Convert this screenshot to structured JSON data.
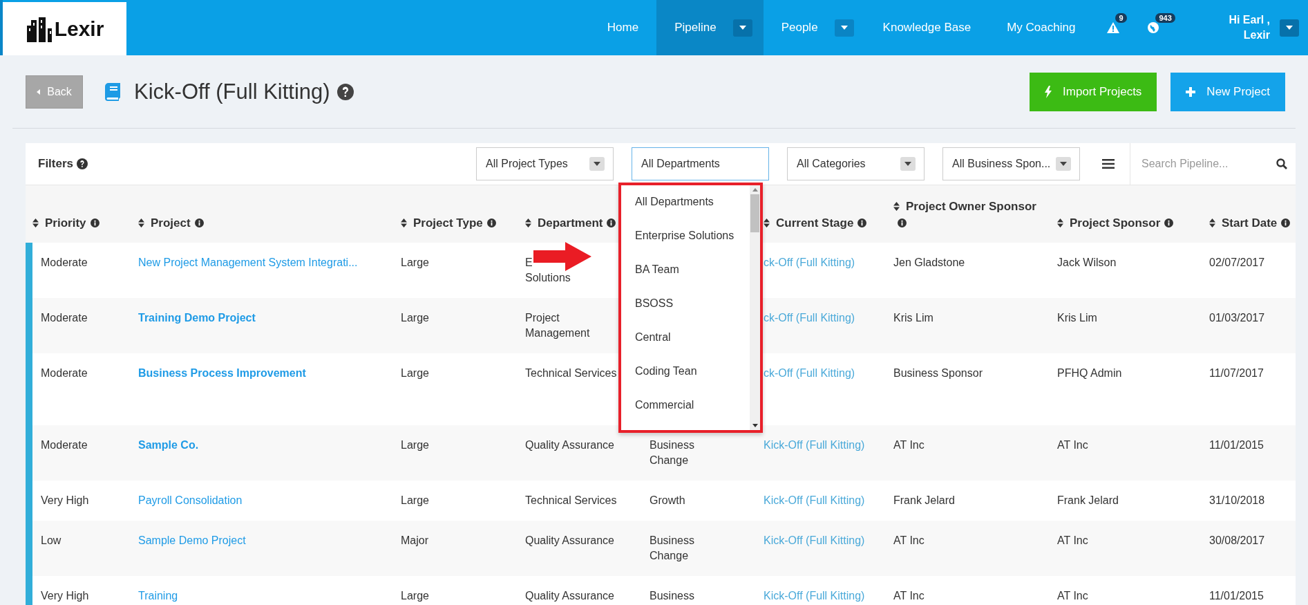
{
  "logo": {
    "text": "Lexir"
  },
  "nav": {
    "items": [
      {
        "label": "Home",
        "selected": false,
        "has_menu": false
      },
      {
        "label": "Pipeline",
        "selected": true,
        "has_menu": true
      },
      {
        "label": "People",
        "selected": false,
        "has_menu": true
      },
      {
        "label": "Knowledge Base",
        "selected": false,
        "has_menu": false
      },
      {
        "label": "My Coaching",
        "selected": false,
        "has_menu": false
      }
    ],
    "alerts": [
      {
        "kind": "warning",
        "count": "9"
      },
      {
        "kind": "globe",
        "count": "943"
      }
    ],
    "user": {
      "greeting": "Hi Earl ,",
      "name": "Lexir"
    }
  },
  "header": {
    "back": "Back",
    "title": "Kick-Off (Full Kitting)",
    "actions": [
      {
        "kind": "import",
        "label": "Import Projects"
      },
      {
        "kind": "new",
        "label": "New Project"
      }
    ]
  },
  "filters": {
    "label": "Filters",
    "selects": [
      {
        "value": "All Project Types",
        "focused": false
      },
      {
        "value": "All Departments",
        "focused": true
      },
      {
        "value": "All Categories",
        "focused": false
      },
      {
        "value": "All Business Spon...",
        "focused": false
      }
    ],
    "search": {
      "placeholder": "Search Pipeline..."
    }
  },
  "department_dropdown": {
    "options": [
      "All Departments",
      "Enterprise Solutions",
      "BA Team",
      "BSOSS",
      "Central",
      "Coding Tean",
      "Commercial"
    ]
  },
  "table": {
    "columns": [
      {
        "kind": "sortable",
        "label": "Priority"
      },
      {
        "kind": "sortable",
        "label": "Project"
      },
      {
        "kind": "sortable",
        "label": "Project Type"
      },
      {
        "kind": "sortable",
        "label": "Department"
      },
      {
        "kind": "blank"
      },
      {
        "kind": "sortable",
        "label": "Current Stage"
      },
      {
        "kind": "sortable",
        "label": "Project Owner Sponsor"
      },
      {
        "kind": "sortable",
        "label": "Project Sponsor"
      },
      {
        "kind": "sortable",
        "label": "Start Date"
      }
    ],
    "rows": [
      {
        "priority": "Moderate",
        "project": "New Project Management System Integrati...",
        "project_bold": false,
        "type": "Large",
        "department": "E\nSolutions",
        "stage": "ck-Off (Full Kitting)",
        "owner": "Jen Gladstone",
        "sponsor": "Jack Wilson",
        "start_date": "02/07/2017"
      },
      {
        "priority": "Moderate",
        "project": "Training Demo Project",
        "project_bold": true,
        "type": "Large",
        "department": "Project Management",
        "stage": "ck-Off (Full Kitting)",
        "owner": "Kris Lim",
        "sponsor": "Kris Lim",
        "start_date": "01/03/2017"
      },
      {
        "priority": "Moderate",
        "project": "Business Process Improvement",
        "project_bold": true,
        "type": "Large",
        "department": "Technical Services",
        "stage": "ck-Off (Full Kitting)",
        "owner": "Business Sponsor",
        "sponsor": "PFHQ Admin",
        "start_date": "11/07/2017"
      },
      {
        "priority": "Moderate",
        "project": "Sample Co.",
        "project_bold": true,
        "type": "Large",
        "department": "Quality Assurance",
        "category": "Business Change",
        "stage": "Kick-Off (Full Kitting)",
        "owner": "AT Inc",
        "sponsor": "AT Inc",
        "start_date": "11/01/2015"
      },
      {
        "priority": "Very High",
        "project": "Payroll Consolidation",
        "project_bold": false,
        "type": "Large",
        "department": "Technical Services",
        "category": "Growth",
        "stage": "Kick-Off (Full Kitting)",
        "owner": "Frank Jelard",
        "sponsor": "Frank Jelard",
        "start_date": "31/10/2018"
      },
      {
        "priority": "Low",
        "project": "Sample Demo Project",
        "project_bold": false,
        "type": "Major",
        "department": "Quality Assurance",
        "category": "Business Change",
        "stage": "Kick-Off (Full Kitting)",
        "owner": "AT Inc",
        "sponsor": "AT Inc",
        "start_date": "30/08/2017"
      },
      {
        "priority": "Very High",
        "project": "Training",
        "project_bold": false,
        "type": "Large",
        "department": "Quality Assurance",
        "category": "Business",
        "stage": "Kick-Off (Full Kitting)",
        "owner": "AT Inc",
        "sponsor": "AT Inc",
        "start_date": "11/01/2015"
      }
    ]
  }
}
